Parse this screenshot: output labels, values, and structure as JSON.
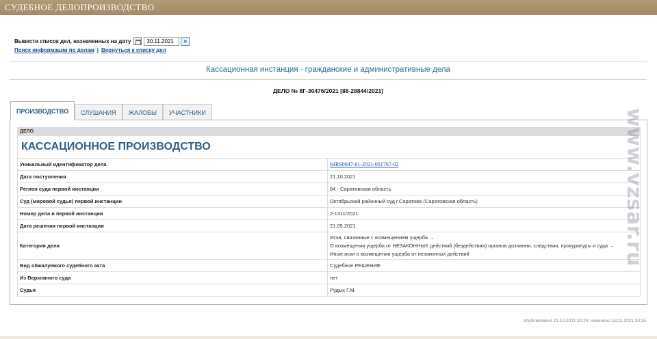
{
  "header": {
    "title": "СУДЕБНОЕ ДЕЛОПРОИЗВОДСТВО"
  },
  "datebar": {
    "label": "Вывести список дел, назначенных на дату",
    "calendar_icon": "calendar-icon",
    "date_value": "30.11.2021",
    "go_icon": "double-chevron-right-icon"
  },
  "links": {
    "search": "Поиск информации по делам",
    "separator": "|",
    "back": "Вернуться к списку дел"
  },
  "heading": "Кассационная инстанция - гражданские и административные дела",
  "case_number": "ДЕЛО № 8Г-30476/2021 [88-28844/2021]",
  "tabs": [
    {
      "label": "ПРОИЗВОДСТВО",
      "active": true
    },
    {
      "label": "СЛУШАНИЯ",
      "active": false
    },
    {
      "label": "ЖАЛОБЫ",
      "active": false
    },
    {
      "label": "УЧАСТНИКИ",
      "active": false
    }
  ],
  "case": {
    "section_label": "ДЕЛО",
    "title": "КАССАЦИОННОЕ ПРОИЗВОДСТВО",
    "rows": [
      {
        "label": "Уникальный идентификатор дела",
        "value": "64RS0047-01-2021-001767-02",
        "link": true
      },
      {
        "label": "Дата поступления",
        "value": "21.10.2021"
      },
      {
        "label": "Регион суда первой инстанции",
        "value": "64 - Саратовская область"
      },
      {
        "label": "Суд (мировой судья) первой инстанции",
        "value": "Октябрьский районный суд г.Саратова (Саратовская область)"
      },
      {
        "label": "Номер дела в первой инстанции",
        "value": "2-1311/2021"
      },
      {
        "label": "Дата решения первой инстанции",
        "value": "21.05.2021"
      },
      {
        "label": "Категория дела",
        "lines": [
          "Иски, связанные с возмещением ущерба →",
          "О возмещении ущерба от НЕЗАКОННЫХ действий (бездействия) органов дознания, следствия, прокуратуры и суда →",
          "Иные иски о возмещении ущерба от незаконных действий"
        ]
      },
      {
        "label": "Вид обжалуемого судебного акта",
        "value": "Судебное РЕШЕНИЕ"
      },
      {
        "label": "Из Верховного суда",
        "value": "нет"
      },
      {
        "label": "Судья",
        "value": "Рудых Г.М."
      }
    ]
  },
  "footer": "опубликовано 21.10.2021 20:24; изменено 18.11.2021 20:15",
  "watermark": "www.vzsar.ru"
}
